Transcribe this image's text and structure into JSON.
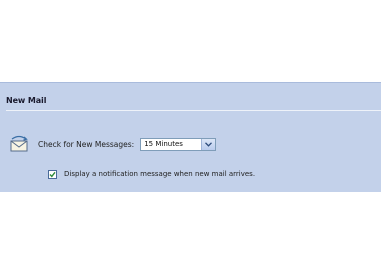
{
  "section": {
    "title": "New Mail"
  },
  "check_messages": {
    "label": "Check for New Messages:",
    "interval_value": "15 Minutes",
    "icon": "mail-envelope-icon"
  },
  "notification": {
    "checked": true,
    "label": "Display a notification message when new mail arrives."
  },
  "colors": {
    "panel_bg": "#c3d1ea",
    "checkbox_border": "#4a6b9a",
    "check_mark": "#2e8b3a"
  }
}
